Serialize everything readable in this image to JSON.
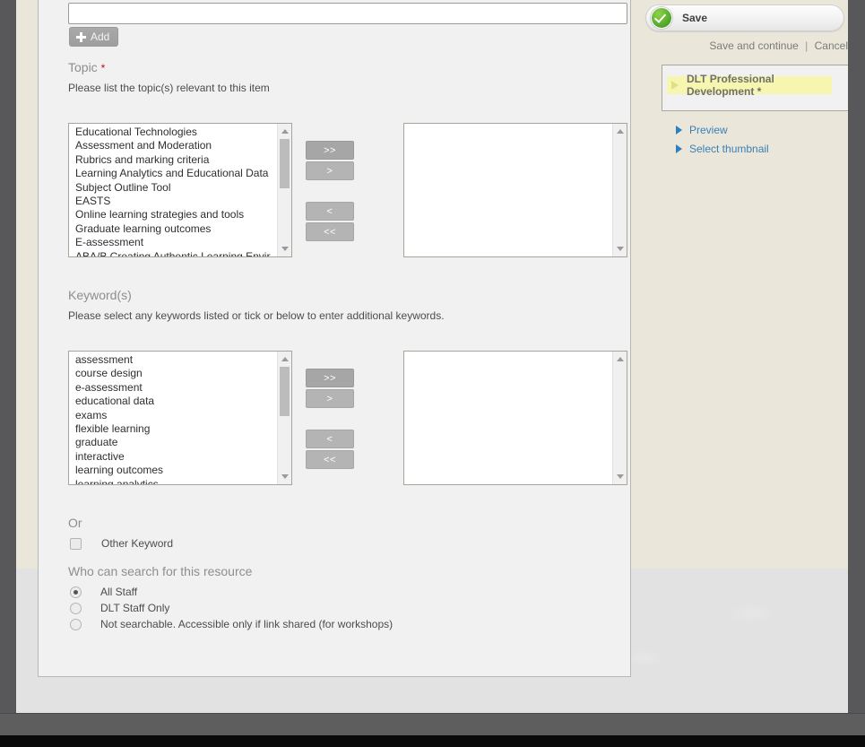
{
  "form": {
    "new_entry_input": {
      "value": "",
      "placeholder": ""
    },
    "add_button_label": "Add",
    "topic": {
      "label": "Topic",
      "required_mark": "*",
      "help": "Please list the topic(s) relevant to this item",
      "available": [
        "Educational Technologies",
        "Assessment and Moderation",
        "Rubrics and marking criteria",
        "Learning Analytics and Educational Data",
        "Subject Outline Tool",
        "EASTS",
        "Online learning strategies and tools",
        "Graduate learning outcomes",
        "E-assessment",
        "ABA/B Creating Authentic Learning Envir"
      ],
      "selected": []
    },
    "keywords": {
      "label": "Keyword(s)",
      "help": "Please select any keywords listed or tick or below to enter additional keywords.",
      "available": [
        "assessment",
        "course design",
        "e-assessment",
        "educational data",
        "exams",
        "flexible learning",
        "graduate",
        "interactive",
        "learning outcomes",
        "learning analytics"
      ],
      "selected": []
    },
    "transfer_buttons": {
      "add_all": ">>",
      "add_one": ">",
      "remove_one": "<",
      "remove_all": "<<"
    },
    "or_label": "Or",
    "other_keyword": {
      "label": "Other Keyword",
      "checked": false
    },
    "visibility": {
      "label": "Who can search for this resource",
      "options": [
        {
          "label": "All Staff",
          "checked": true
        },
        {
          "label": "DLT Staff Only",
          "checked": false
        },
        {
          "label": "Not searchable. Accessible only if link shared (for workshops)",
          "checked": false
        }
      ]
    }
  },
  "sidebar": {
    "save_label": "Save",
    "save_and_continue_label": "Save and continue",
    "separator": "|",
    "cancel_label": "Cancel",
    "nav_highlight": "DLT Professional Development *",
    "links": [
      {
        "label": "Preview"
      },
      {
        "label": "Select thumbnail"
      }
    ]
  },
  "colors": {
    "accent_blue": "#3b7fb5",
    "highlight_yellow": "#f6f6b0",
    "required_red": "#d0021b",
    "save_green": "#5cb030",
    "page_beige": "#eae7da",
    "panel_gray": "#f1f1f1"
  }
}
